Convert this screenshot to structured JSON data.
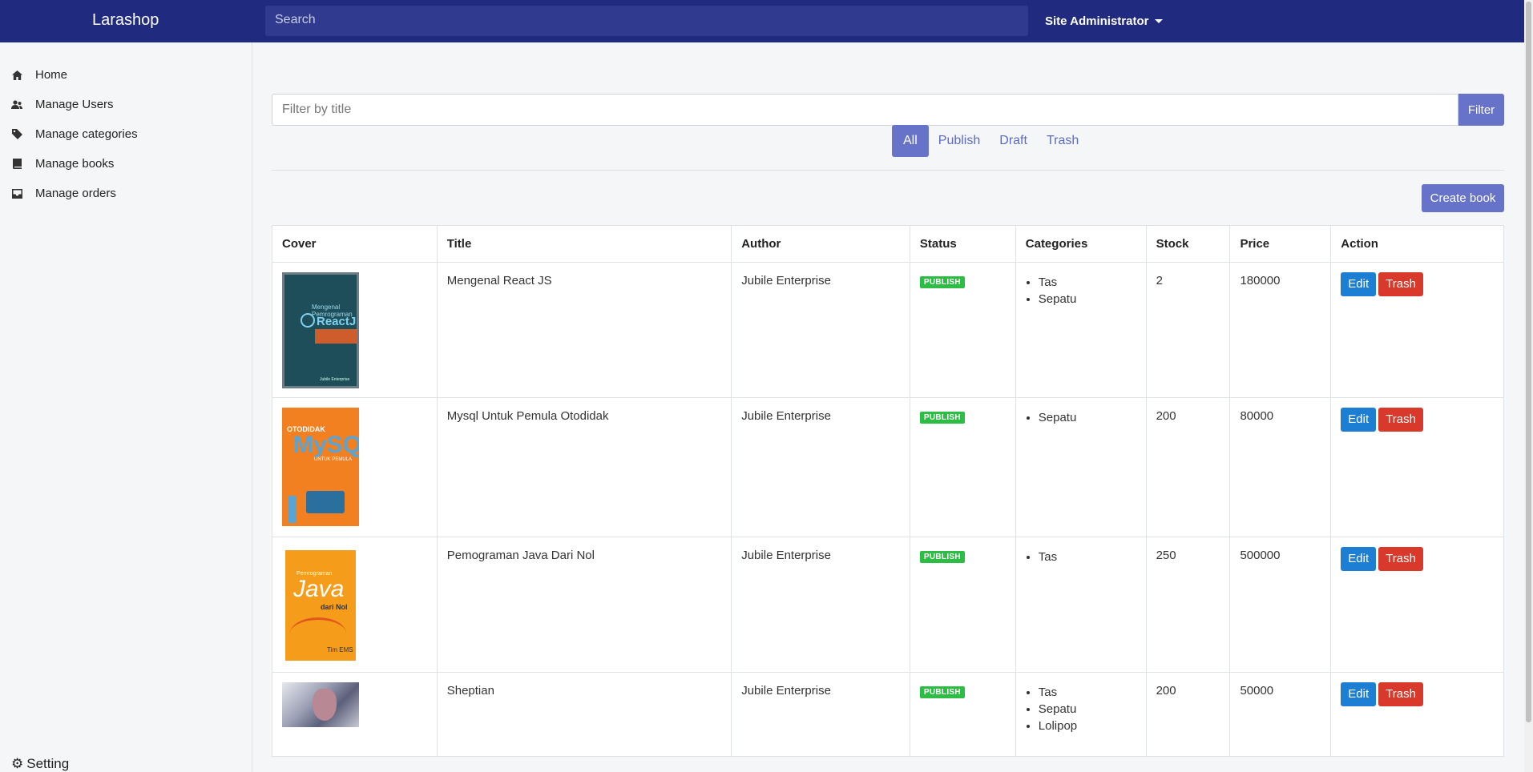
{
  "navbar": {
    "brand": "Larashop",
    "search_placeholder": "Search",
    "user": "Site Administrator"
  },
  "sidebar": {
    "items": [
      {
        "label": "Home",
        "icon": "home-icon"
      },
      {
        "label": "Manage Users",
        "icon": "users-icon"
      },
      {
        "label": "Manage categories",
        "icon": "tag-icon"
      },
      {
        "label": "Manage books",
        "icon": "book-icon"
      },
      {
        "label": "Manage orders",
        "icon": "inbox-icon"
      }
    ],
    "setting": "Setting"
  },
  "filter": {
    "placeholder": "Filter by title",
    "button": "Filter"
  },
  "status_tabs": [
    {
      "label": "All",
      "active": true
    },
    {
      "label": "Publish",
      "active": false
    },
    {
      "label": "Draft",
      "active": false
    },
    {
      "label": "Trash",
      "active": false
    }
  ],
  "create_button": "Create book",
  "table": {
    "headers": [
      "Cover",
      "Title",
      "Author",
      "Status",
      "Categories",
      "Stock",
      "Price",
      "Action"
    ],
    "edit_label": "Edit",
    "trash_label": "Trash",
    "rows": [
      {
        "cover_text": {
          "line1": "Mengenal Pemrograman",
          "line2": "ReactJS",
          "author": "Jubile Enterprise"
        },
        "title": "Mengenal React JS",
        "author": "Jubile Enterprise",
        "status": "PUBLISH",
        "categories": [
          "Tas",
          "Sepatu"
        ],
        "stock": "2",
        "price": "180000"
      },
      {
        "cover_text": {
          "line1": "OTODIDAK",
          "line2": "MySQL",
          "line3": "UNTUK PEMULA"
        },
        "title": "Mysql Untuk Pemula Otodidak",
        "author": "Jubile Enterprise",
        "status": "PUBLISH",
        "categories": [
          "Sepatu"
        ],
        "stock": "200",
        "price": "80000"
      },
      {
        "cover_text": {
          "line1": "Pemrograman",
          "line2": "Java",
          "line3": "dari Nol",
          "author": "Tim EMS"
        },
        "title": "Pemograman Java Dari Nol",
        "author": "Jubile Enterprise",
        "status": "PUBLISH",
        "categories": [
          "Tas"
        ],
        "stock": "250",
        "price": "500000"
      },
      {
        "title": "Sheptian",
        "author": "Jubile Enterprise",
        "status": "PUBLISH",
        "categories": [
          "Tas",
          "Sepatu",
          "Lolipop"
        ],
        "stock": "200",
        "price": "50000"
      }
    ]
  },
  "colors": {
    "navbar": "#202a7e",
    "primary": "#6673c9",
    "edit": "#1d7fd4",
    "trash": "#d8392b",
    "publish_badge": "#2dbd45"
  }
}
